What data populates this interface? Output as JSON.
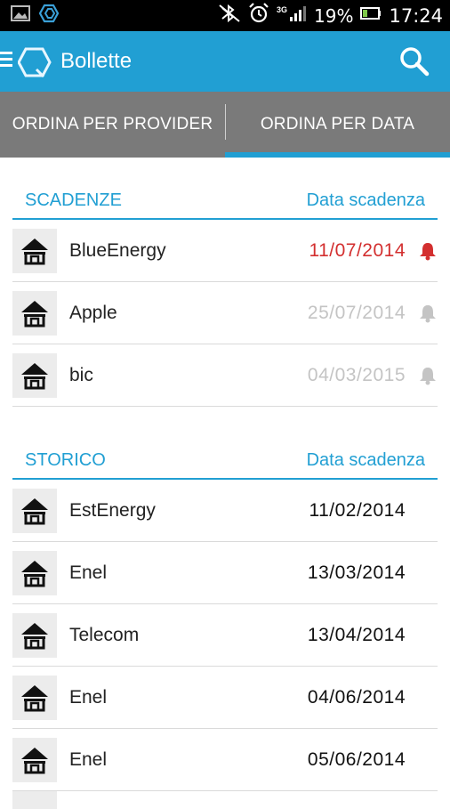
{
  "status_bar": {
    "network": "3G",
    "battery": "19%",
    "time": "17:24"
  },
  "app_bar": {
    "title": "Bollette"
  },
  "tabs": [
    {
      "label": "ORDINA PER PROVIDER",
      "active": false
    },
    {
      "label": "ORDINA PER DATA",
      "active": true
    }
  ],
  "colors": {
    "accent": "#219fd3",
    "overdue": "#d32f2f",
    "future": "#c4c4c4",
    "tab_bg": "#7a7a7a"
  },
  "scadenze": {
    "title": "SCADENZE",
    "column": "Data scadenza",
    "rows": [
      {
        "name": "BlueEnergy",
        "date": "11/07/2014",
        "state": "overdue"
      },
      {
        "name": "Apple",
        "date": "25/07/2014",
        "state": "future"
      },
      {
        "name": "bic",
        "date": "04/03/2015",
        "state": "future"
      }
    ]
  },
  "storico": {
    "title": "STORICO",
    "column": "Data scadenza",
    "rows": [
      {
        "name": "EstEnergy",
        "date": "11/02/2014"
      },
      {
        "name": "Enel",
        "date": "13/03/2014"
      },
      {
        "name": "Telecom",
        "date": "13/04/2014"
      },
      {
        "name": "Enel",
        "date": "04/06/2014"
      },
      {
        "name": "Enel",
        "date": "05/06/2014"
      }
    ]
  }
}
